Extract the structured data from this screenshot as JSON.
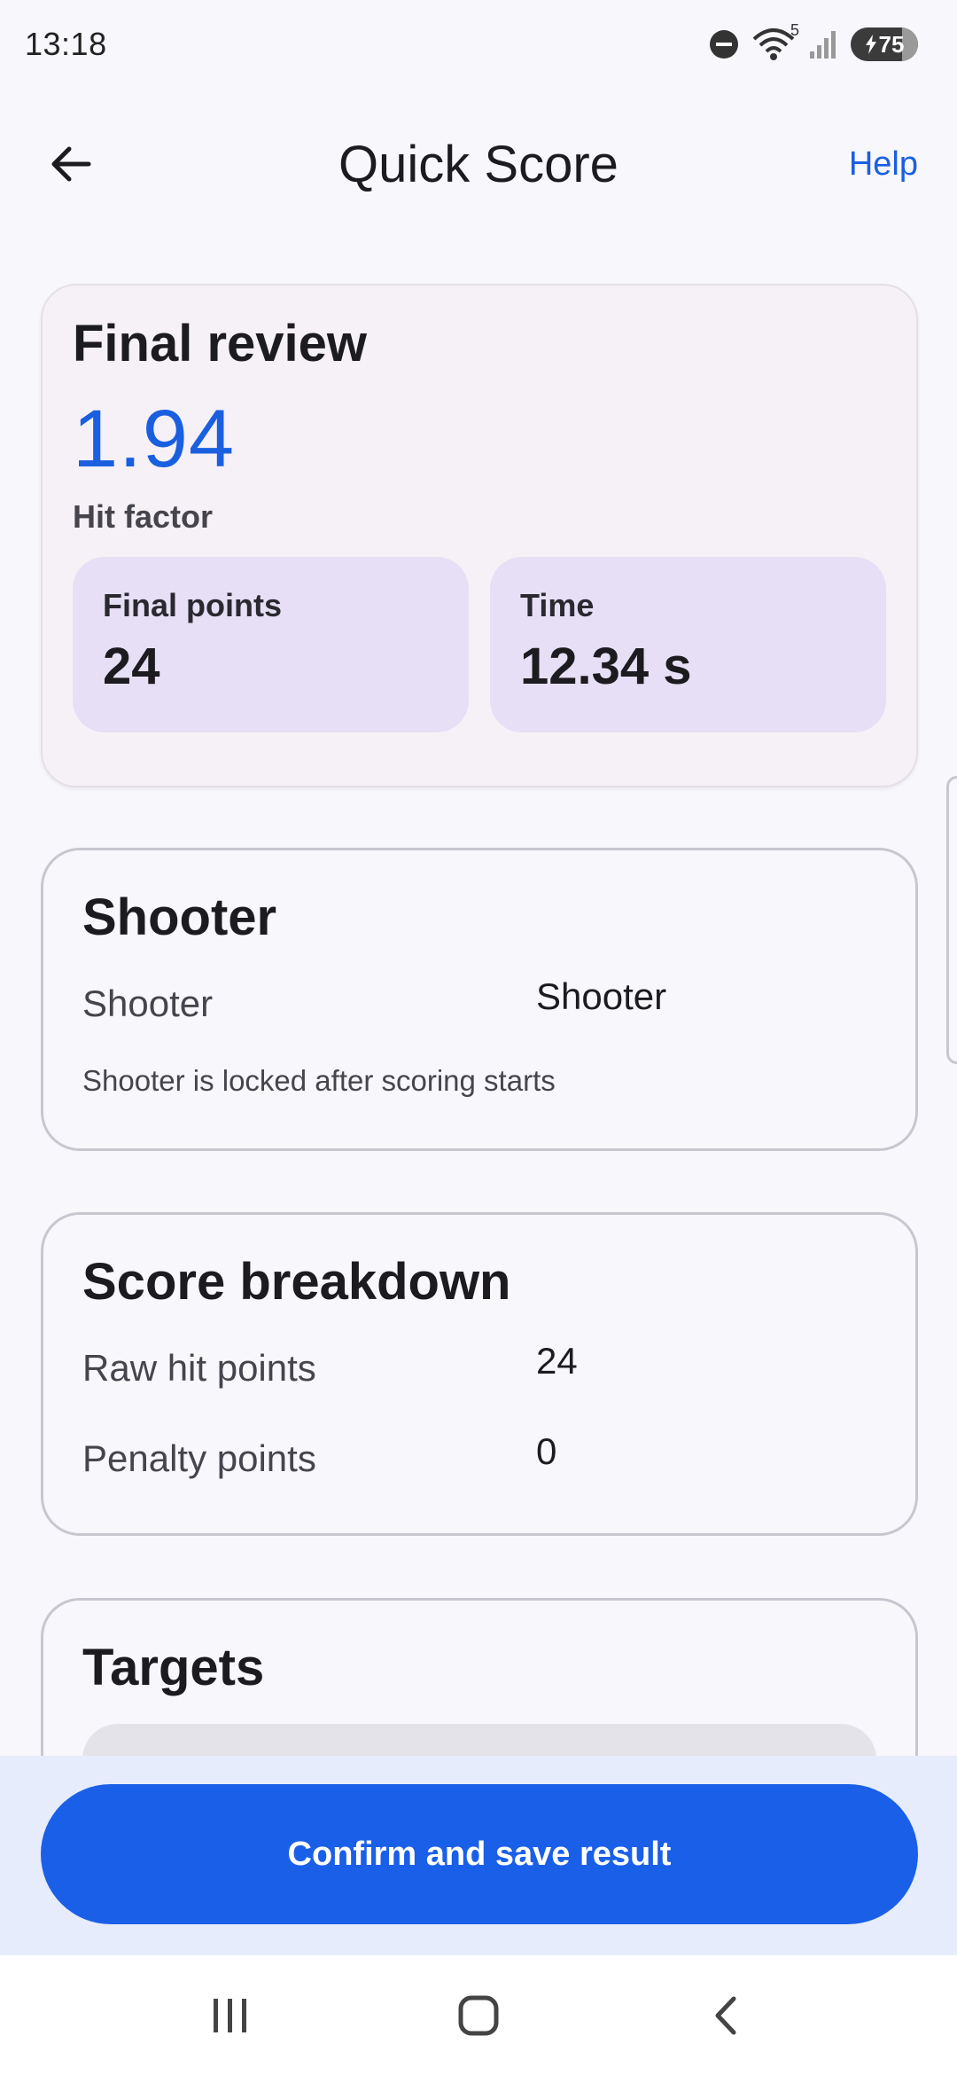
{
  "status_bar": {
    "time": "13:18",
    "wifi_badge": "5",
    "battery_level": "75",
    "icons": [
      "dnd-icon",
      "wifi-icon",
      "signal-icon",
      "battery-charging-icon"
    ]
  },
  "app_bar": {
    "title": "Quick Score",
    "help_label": "Help",
    "back_icon": "arrow-left-icon"
  },
  "final_review": {
    "title": "Final review",
    "hit_factor_value": "1.94",
    "hit_factor_label": "Hit factor",
    "final_points_label": "Final points",
    "final_points_value": "24",
    "time_label": "Time",
    "time_value": "12.34 s"
  },
  "shooter_section": {
    "title": "Shooter",
    "field_label": "Shooter",
    "field_value": "Shooter",
    "note": "Shooter is locked after scoring starts"
  },
  "score_breakdown": {
    "title": "Score breakdown",
    "rows": [
      {
        "label": "Raw hit points",
        "value": "24"
      },
      {
        "label": "Penalty points",
        "value": "0"
      }
    ]
  },
  "targets_section": {
    "title": "Targets"
  },
  "actions": {
    "confirm_label": "Confirm and save result"
  },
  "colors": {
    "accent": "#1a5fe8",
    "hit_factor": "#1a5fe0",
    "stat_box": "#e7dff5",
    "review_card": "#f6f1f6",
    "action_bar": "#e6ecfb"
  },
  "nav_bar": {
    "icons": [
      "recents-icon",
      "home-icon",
      "back-icon"
    ]
  }
}
